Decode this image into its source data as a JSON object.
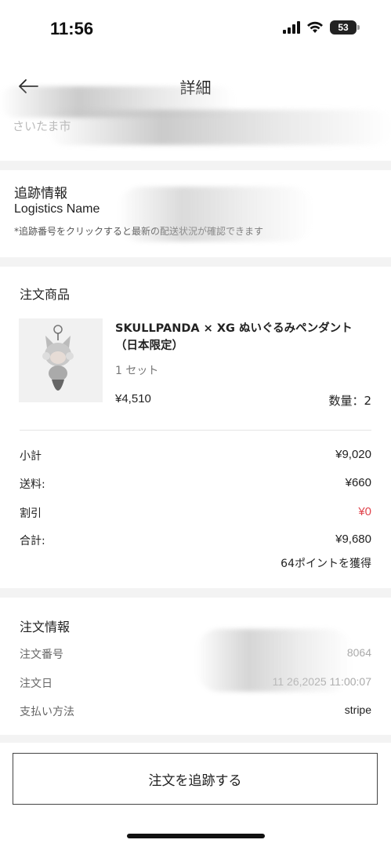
{
  "status_bar": {
    "time": "11:56",
    "battery": "53"
  },
  "nav": {
    "title": "詳細"
  },
  "address": {
    "text": "さいたま市"
  },
  "tracking": {
    "title": "追跡情報",
    "logistics_name": "Logistics Name",
    "note": "*追跡番号をクリックすると最新の配送状況が確認できます"
  },
  "order_goods": {
    "title": "注文商品",
    "product": {
      "name": "SKULLPANDA × XG ぬいぐるみペンダント（日本限定）",
      "variant": "1 セット",
      "price": "¥4,510",
      "quantity": "数量：2"
    },
    "summary": [
      {
        "label": "小計",
        "value": "¥9,020",
        "color": "#222222"
      },
      {
        "label": "送料:",
        "value": "¥660",
        "color": "#222222"
      },
      {
        "label": "割引",
        "value": "¥0",
        "color": "#e0464e"
      },
      {
        "label": "合計:",
        "value": "¥9,680",
        "color": "#222222"
      }
    ],
    "points": "64ポイントを獲得"
  },
  "order_info": {
    "title": "注文情報",
    "rows": [
      {
        "label": "注文番号",
        "value": "8064"
      },
      {
        "label": "注文日",
        "value": "11 26,2025 11:00:07"
      },
      {
        "label": "支払い方法",
        "value": "stripe"
      }
    ]
  },
  "buttons": {
    "track_order": "注文を追跡する"
  }
}
